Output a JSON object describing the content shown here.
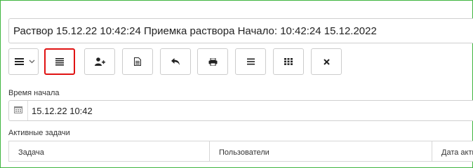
{
  "document": {
    "title": "Раствор 15.12.22 10:42:24 Приемка раствора Начало: 10:42:24 15.12.2022"
  },
  "toolbar": {
    "buttons": [
      {
        "icon": "menu-dropdown-icon"
      },
      {
        "icon": "list-details-icon",
        "selected": true
      },
      {
        "icon": "add-user-icon"
      },
      {
        "icon": "document-icon"
      },
      {
        "icon": "reply-icon"
      },
      {
        "icon": "print-icon"
      },
      {
        "icon": "list-icon"
      },
      {
        "icon": "grid-icon"
      },
      {
        "icon": "close-icon"
      }
    ],
    "selected_color": "#e01212"
  },
  "start_time": {
    "label": "Время начала",
    "value": "15.12.22 10:42"
  },
  "tasks": {
    "label": "Активные задачи",
    "columns": [
      "Задача",
      "Пользователи",
      "Дата акти"
    ]
  },
  "colors": {
    "frame_border": "#3fb53f"
  }
}
